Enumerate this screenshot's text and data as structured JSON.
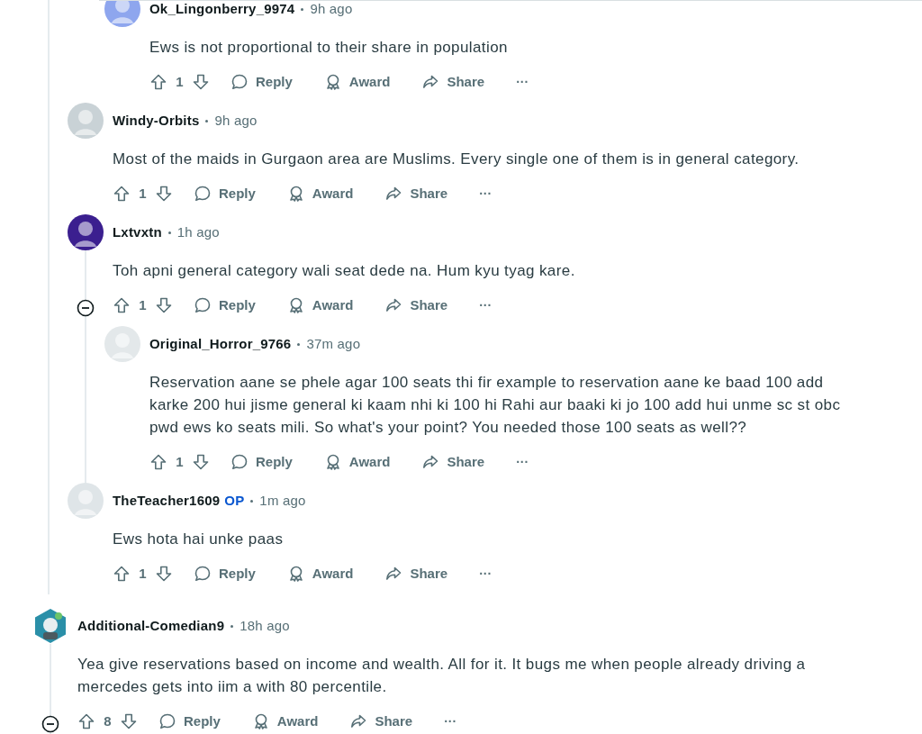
{
  "thread": {
    "earlier_replies": [
      {
        "author": "Ok_Lingonberry_9974",
        "time": "9h ago",
        "avatar": {
          "kind": "circle",
          "color": "#8ea6ee"
        },
        "body": [
          "Ews is not proportional to their share in population"
        ],
        "votes": "1",
        "actions": [
          "Reply",
          "Award",
          "Share"
        ],
        "more": "···"
      }
    ],
    "replies": [
      {
        "author": "Windy-Orbits",
        "time": "9h ago",
        "avatar": {
          "kind": "circle",
          "color": "#c9d2d6"
        },
        "body": [
          "Most of the maids in Gurgaon area are Muslims. Every single one of them is in general category."
        ],
        "votes": "1",
        "actions": [
          "Reply",
          "Award",
          "Share"
        ],
        "more": "···"
      },
      {
        "author": "Lxtvxtn",
        "time": "1h ago",
        "avatar": {
          "kind": "circle",
          "color": "#3b1f8f"
        },
        "body": [
          "Toh apni general category wali seat dede na. Hum kyu tyag kare."
        ],
        "votes": "1",
        "actions": [
          "Reply",
          "Award",
          "Share"
        ],
        "more": "···",
        "expanded": true,
        "children": [
          {
            "author": "Original_Horror_9766",
            "time": "37m ago",
            "avatar": {
              "kind": "circle",
              "color": "#e3e8ea"
            },
            "body": [
              "Reservation aane se phele agar 100 seats thi fir example to reservation aane ke baad 100 add karke 200 hui jisme general ki kaam nhi ki 100 hi Rahi aur baaki ki jo 100 add hui unme sc st obc pwd ews ko seats mili. So what's your point? You needed those 100 seats as well??"
            ],
            "votes": "1",
            "actions": [
              "Reply",
              "Award",
              "Share"
            ],
            "more": "···"
          }
        ]
      },
      {
        "author": "TheTeacher1609",
        "badge": "OP",
        "time": "1m ago",
        "avatar": {
          "kind": "circle",
          "color": "#dfe5e8"
        },
        "body": [
          "Ews hota hai unke paas"
        ],
        "votes": "1",
        "actions": [
          "Reply",
          "Award",
          "Share"
        ],
        "more": "···"
      }
    ]
  },
  "comments": [
    {
      "author": "Additional-Comedian9",
      "time": "18h ago",
      "avatar": {
        "kind": "hexagon",
        "color": "#2a8fa8"
      },
      "body": [
        "Yea give reservations based on income and wealth. All for it. It bugs me when people already driving a mercedes gets into iim a with 80 percentile."
      ],
      "votes": "8",
      "actions": [
        "Reply",
        "Award",
        "Share"
      ],
      "more": "···",
      "expanded": true
    }
  ]
}
